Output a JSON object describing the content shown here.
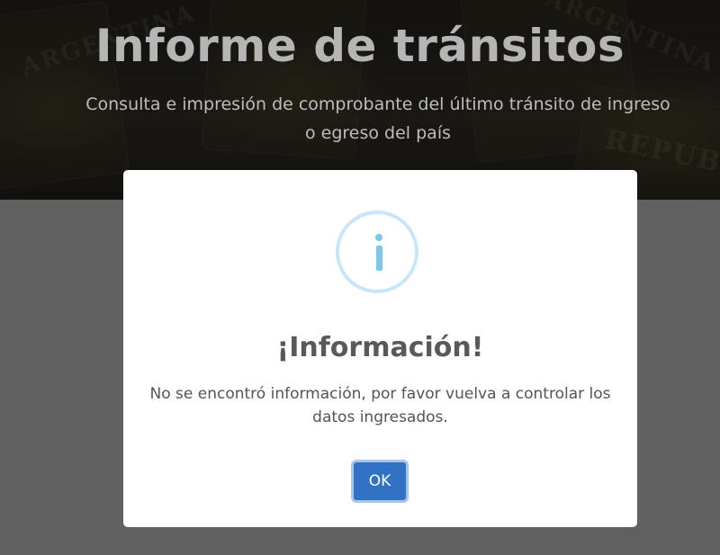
{
  "hero": {
    "title": "Informe de tránsitos",
    "subtitle": "Consulta e impresión de comprobante del último tránsito de ingreso o egreso del país"
  },
  "modal": {
    "icon": "info-icon",
    "title": "¡Información!",
    "message": "No se encontró información, por favor vuelva a controlar los datos ingresados.",
    "ok_label": "OK"
  },
  "colors": {
    "accent_button": "#3172c4",
    "info_icon": "#7ec6ec",
    "backdrop": "#9c9c9c"
  }
}
